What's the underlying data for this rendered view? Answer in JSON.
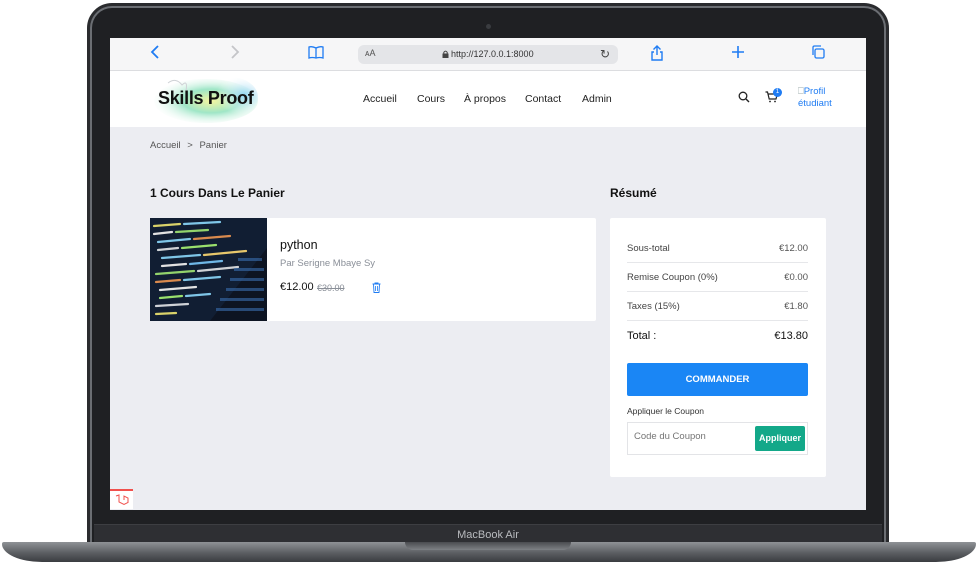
{
  "device": {
    "chin_label": "MacBook Air"
  },
  "browser": {
    "url_aa": "ᴀA",
    "url": "http://127.0.0.1:8000"
  },
  "header": {
    "logo": "Skills Proof",
    "nav": [
      "Accueil",
      "Cours",
      "À propos",
      "Contact",
      "Admin"
    ],
    "cart_count": "1",
    "profile_alt": "Profil étudiant"
  },
  "breadcrumb": {
    "home": "Accueil",
    "sep": ">",
    "current": "Panier"
  },
  "cart": {
    "title": "1 Cours Dans Le Panier",
    "items": [
      {
        "name": "python",
        "author": "Par Serigne Mbaye Sy",
        "price": "€12.00",
        "old_price": "€30.00"
      }
    ]
  },
  "summary": {
    "title": "Résumé",
    "rows": [
      {
        "label": "Sous-total",
        "value": "€12.00"
      },
      {
        "label": "Remise Coupon (0%)",
        "value": "€0.00"
      },
      {
        "label": "Taxes (15%)",
        "value": "€1.80"
      }
    ],
    "total_label": "Total :",
    "total_value": "€13.80",
    "order_button": "COMMANDER",
    "coupon_label": "Appliquer le Coupon",
    "coupon_placeholder": "Code du Coupon",
    "coupon_button": "Appliquer"
  },
  "colors": {
    "accent": "#1a86f5",
    "green": "#13a889",
    "page_bg": "#ecedf2"
  }
}
